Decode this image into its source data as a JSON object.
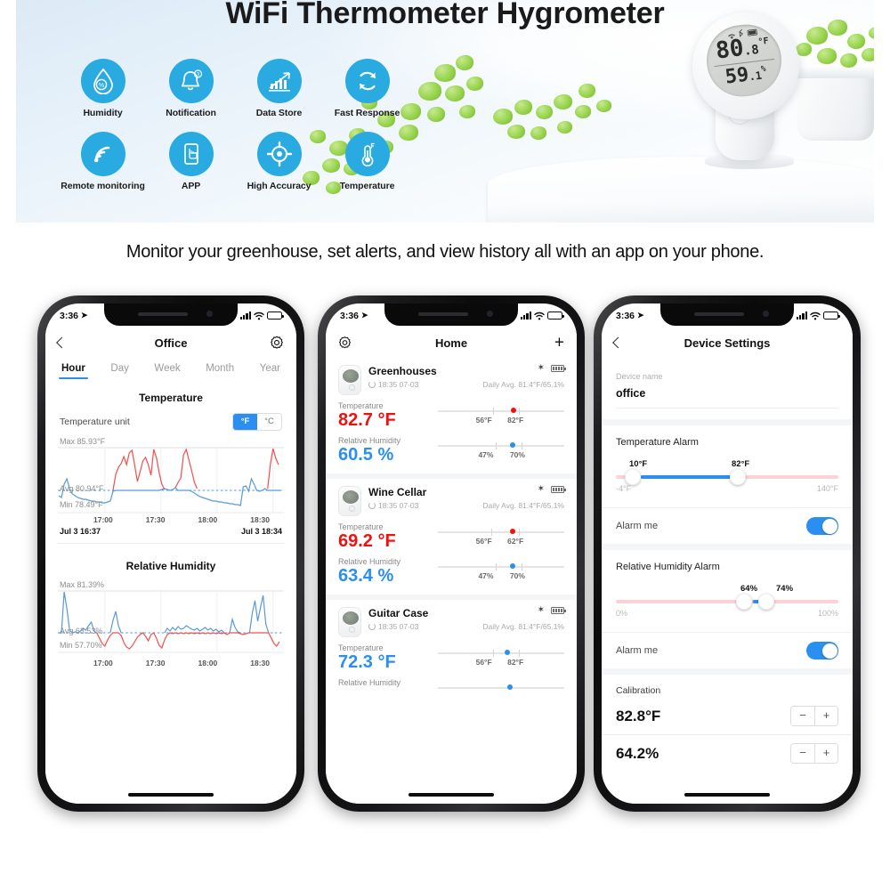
{
  "hero": {
    "title": "WiFi Thermometer Hygrometer",
    "accent_color": "#29abe2",
    "features": [
      {
        "label": "Humidity",
        "icon": "humidity-drop-icon"
      },
      {
        "label": "Notification",
        "icon": "bell-icon"
      },
      {
        "label": "Data Store",
        "icon": "bar-chart-icon"
      },
      {
        "label": "Fast Response",
        "icon": "refresh-cycle-icon"
      },
      {
        "label": "Remote monitoring",
        "icon": "wifi-signal-icon"
      },
      {
        "label": "APP",
        "icon": "phone-tap-icon"
      },
      {
        "label": "High Accuracy",
        "icon": "target-crosshair-icon"
      },
      {
        "label": "Temperature",
        "icon": "thermometer-icon"
      }
    ],
    "device_display": {
      "temperature_main": "80",
      "temperature_dec": ".8",
      "temperature_unit": "°F",
      "humidity_main": "59",
      "humidity_dec": ".1",
      "humidity_unit": "%",
      "status_icons": "wifi bluetooth battery"
    }
  },
  "caption": "Monitor your greenhouse, set alerts, and view history all with an app on your phone.",
  "status_bar": {
    "time": "3:36",
    "location_arrow": "➤"
  },
  "phone1": {
    "nav": {
      "back_icon": "chevron-left-icon",
      "title": "Office",
      "settings_icon": "gear-icon"
    },
    "tabs": [
      {
        "label": "Hour",
        "active": true
      },
      {
        "label": "Day",
        "active": false
      },
      {
        "label": "Week",
        "active": false
      },
      {
        "label": "Month",
        "active": false
      },
      {
        "label": "Year",
        "active": false
      }
    ],
    "temperature": {
      "section_title": "Temperature",
      "unit_label": "Temperature unit",
      "unit_options": [
        "°F",
        "°C"
      ],
      "unit_selected": "°F",
      "max_label": "Max 85.93°F",
      "avg_label": "Avg 80.94°F",
      "min_label": "Min 78.49°F",
      "x_ticks": [
        "17:00",
        "17:30",
        "18:00",
        "18:30"
      ],
      "range_start": "Jul 3  16:37",
      "range_end": "Jul 3  18:34"
    },
    "humidity": {
      "section_title": "Relative Humidity",
      "max_label": "Max 81.39%",
      "avg_label": "Avg 63.53%",
      "min_label": "Min 57.70%",
      "x_ticks": [
        "17:00",
        "17:30",
        "18:00",
        "18:30"
      ]
    }
  },
  "phone2": {
    "nav": {
      "settings_icon": "gear-icon",
      "title": "Home",
      "add_icon": "plus-icon"
    },
    "cards": [
      {
        "name": "Greenhouses",
        "sync_time": "18:35 07-03",
        "daily_avg": "Daily Avg. 81.4°F/65.1%",
        "bluetooth_icon": "bluetooth-icon",
        "battery_icon": "battery-full-icon",
        "temperature": {
          "label": "Temperature",
          "value": "82.7 °F",
          "color": "#f01010",
          "low": "56°F",
          "high": "82°F",
          "dot_pct": 58,
          "low_pct": 44,
          "high_pct": 64
        },
        "humidity": {
          "label": "Relative Humidity",
          "value": "60.5 %",
          "color": "#2a8ff0",
          "low": "47%",
          "high": "70%",
          "dot_pct": 58,
          "low_pct": 46,
          "high_pct": 66
        }
      },
      {
        "name": "Wine Cellar",
        "sync_time": "18:35 07-03",
        "daily_avg": "Daily Avg. 81.4°F/65.1%",
        "bluetooth_icon": "bluetooth-icon",
        "battery_icon": "battery-full-icon",
        "temperature": {
          "label": "Temperature",
          "value": "69.2 °F",
          "color": "#f01010",
          "low": "56°F",
          "high": "62°F",
          "dot_pct": 58,
          "low_pct": 42,
          "high_pct": 64
        },
        "humidity": {
          "label": "Relative Humidity",
          "value": "63.4 %",
          "color": "#2a8ff0",
          "low": "47%",
          "high": "70%",
          "dot_pct": 58,
          "low_pct": 46,
          "high_pct": 66
        }
      },
      {
        "name": "Guitar Case",
        "sync_time": "18:35 07-03",
        "daily_avg": "Daily Avg. 81.4°F/65.1%",
        "bluetooth_icon": "bluetooth-icon",
        "battery_icon": "battery-full-icon",
        "temperature": {
          "label": "Temperature",
          "value": "72.3 °F",
          "color": "#2a8ff0",
          "low": "56°F",
          "high": "82°F",
          "dot_pct": 53,
          "low_pct": 44,
          "high_pct": 64
        },
        "humidity": {
          "label": "Relative Humidity",
          "value": "",
          "color": "#2a8ff0",
          "low": "",
          "high": "",
          "dot_pct": 55,
          "low_pct": 46,
          "high_pct": 66
        }
      }
    ]
  },
  "phone3": {
    "nav": {
      "back_icon": "chevron-left-icon",
      "title": "Device Settings"
    },
    "device_name": {
      "caption": "Device name",
      "value": "office"
    },
    "temp_alarm": {
      "heading": "Temperature Alarm",
      "low_value": "10°F",
      "high_value": "82°F",
      "min_label": "-4°F",
      "max_label": "140°F",
      "low_pct": 11,
      "high_pct": 58,
      "toggle_label": "Alarm me",
      "toggle_on": true
    },
    "hum_alarm": {
      "heading": "Relative Humidity Alarm",
      "low_value": "64%",
      "high_value": "74%",
      "min_label": "0%",
      "max_label": "100%",
      "low_pct": 61,
      "high_pct": 71,
      "toggle_label": "Alarm me",
      "toggle_on": true
    },
    "calibration": {
      "heading": "Calibration",
      "rows": [
        {
          "value": "82.8°F",
          "minus": "−",
          "plus": "+"
        },
        {
          "value": "64.2%",
          "minus": "−",
          "plus": "+"
        }
      ]
    }
  },
  "chart_data": [
    {
      "type": "line",
      "title": "Temperature",
      "ylabel": "°F",
      "xlabel": "",
      "ylim": [
        78.49,
        85.93
      ],
      "stats": {
        "max": 85.93,
        "avg": 80.94,
        "min": 78.49
      },
      "x_tick_labels": [
        "17:00",
        "17:30",
        "18:00",
        "18:30"
      ],
      "x_range": [
        "Jul 3  16:37",
        "Jul 3  18:34"
      ],
      "grid": true,
      "legend": "none",
      "series": [
        {
          "name": "Temperature",
          "note": "blue below avg, red above avg",
          "values": [
            79.1,
            78.9,
            80.5,
            81.2,
            80.0,
            79.4,
            79.2,
            79.0,
            78.9,
            78.8,
            78.8,
            78.7,
            78.6,
            78.6,
            78.55,
            78.5,
            78.5,
            78.49,
            78.5,
            78.6,
            82.1,
            83.0,
            83.4,
            84.2,
            83.3,
            84.6,
            84.9,
            83.1,
            81.3,
            82.4,
            83.6,
            84.0,
            83.2,
            82.0,
            85.9,
            85.0,
            83.2,
            81.8,
            81.2,
            81.4,
            81.0,
            80.9,
            81.0,
            81.6,
            84.3,
            85.0,
            83.8,
            82.5,
            81.2,
            80.6,
            80.2,
            79.9,
            79.6,
            79.4,
            79.2,
            79.1,
            79.0,
            78.9,
            78.85,
            78.8,
            78.75,
            78.7,
            78.7,
            78.65,
            78.6,
            78.6,
            78.55,
            78.5,
            80.2,
            80.3,
            79.7,
            81.3,
            80.7,
            79.9,
            79.8,
            79.9,
            80.1,
            83.0,
            85.8,
            84.6,
            83.9
          ]
        }
      ]
    },
    {
      "type": "line",
      "title": "Relative Humidity",
      "ylabel": "%",
      "xlabel": "",
      "ylim": [
        57.7,
        81.39
      ],
      "stats": {
        "max": 81.39,
        "avg": 63.53,
        "min": 57.7
      },
      "x_tick_labels": [
        "17:00",
        "17:30",
        "18:00",
        "18:30"
      ],
      "grid": true,
      "legend": "none",
      "series": [
        {
          "name": "Relative Humidity",
          "note": "blue above avg, red below avg",
          "values": [
            63.0,
            81.4,
            74.0,
            64.5,
            63.4,
            64.0,
            63.8,
            64.2,
            65.0,
            64.6,
            65.4,
            66.0,
            63.0,
            60.0,
            58.6,
            59.5,
            61.0,
            62.0,
            60.2,
            58.9,
            66.5,
            63.0,
            60.0,
            58.2,
            57.7,
            58.4,
            60.1,
            61.0,
            62.4,
            63.4,
            62.0,
            60.6,
            63.6,
            64.2,
            61.4,
            58.0,
            57.9,
            60.5,
            62.0,
            62.6,
            63.0,
            63.2,
            63.6,
            64.0,
            63.4,
            63.2,
            63.8,
            64.2,
            64.0,
            63.7,
            63.4,
            63.6,
            64.0,
            64.4,
            64.1,
            63.8,
            63.5,
            63.3,
            63.6,
            63.9,
            63.6,
            63.4,
            63.2,
            63.5,
            66.5,
            64.0,
            62.4,
            62.8,
            63.0,
            63.2,
            63.4,
            70.5,
            68.0,
            64.0,
            74.4,
            70.0,
            63.0,
            59.4,
            58.6,
            59.2,
            60.0
          ]
        }
      ]
    }
  ]
}
